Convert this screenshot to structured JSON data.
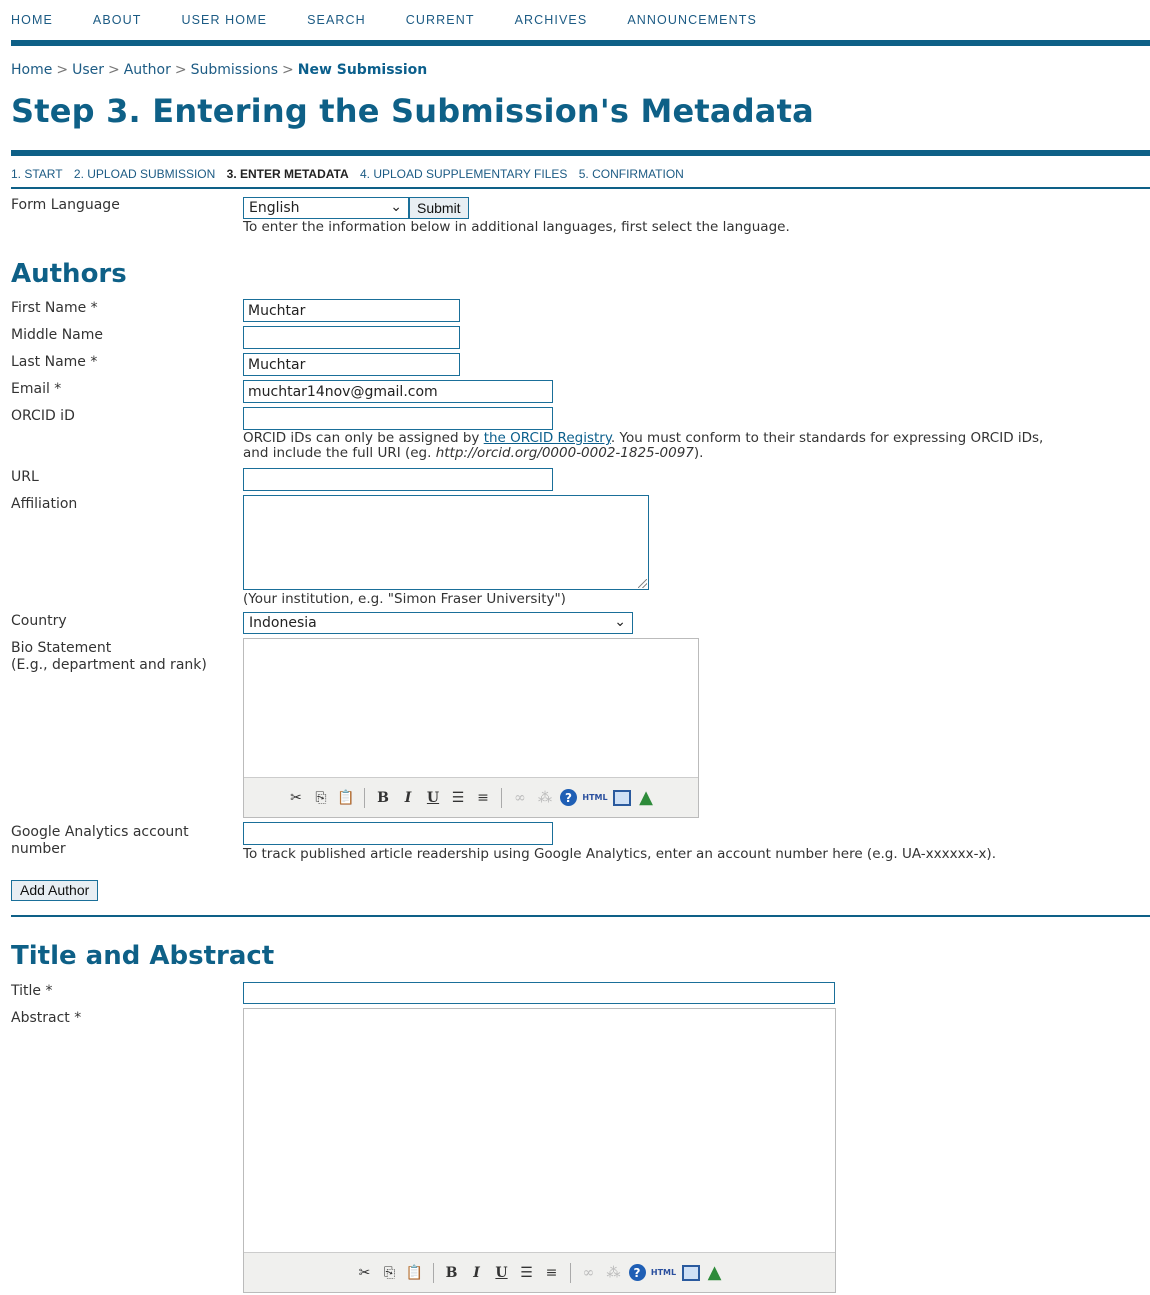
{
  "nav": [
    "HOME",
    "ABOUT",
    "USER HOME",
    "SEARCH",
    "CURRENT",
    "ARCHIVES",
    "ANNOUNCEMENTS"
  ],
  "breadcrumb": [
    "Home",
    "User",
    "Author",
    "Submissions",
    "New Submission"
  ],
  "breadcrumb_separator": ">",
  "page_title": "Step 3. Entering the Submission's Metadata",
  "steps": [
    {
      "label": "1. START"
    },
    {
      "label": "2. UPLOAD SUBMISSION"
    },
    {
      "label": "3. ENTER METADATA",
      "active": true
    },
    {
      "label": "4. UPLOAD SUPPLEMENTARY FILES"
    },
    {
      "label": "5. CONFIRMATION"
    }
  ],
  "form_language": {
    "label": "Form Language",
    "value": "English",
    "submit_label": "Submit",
    "note": "To enter the information below in additional languages, first select the language."
  },
  "authors": {
    "heading": "Authors",
    "first_name": {
      "label": "First Name *",
      "value": "Muchtar"
    },
    "middle_name": {
      "label": "Middle Name",
      "value": ""
    },
    "last_name": {
      "label": "Last Name *",
      "value": "Muchtar"
    },
    "email": {
      "label": "Email *",
      "value": "muchtar14nov@gmail.com"
    },
    "orcid": {
      "label": "ORCID iD",
      "value": "",
      "note_before": "ORCID iDs can only be assigned by ",
      "note_link": "the ORCID Registry",
      "note_after": ". You must conform to their standards for expressing ORCID iDs,",
      "note_line2_before": "and include the full URI (eg. ",
      "note_line2_italic": "http://orcid.org/0000-0002-1825-0097",
      "note_line2_after": ")."
    },
    "url": {
      "label": "URL",
      "value": ""
    },
    "affiliation": {
      "label": "Affiliation",
      "note": "(Your institution, e.g. \"Simon Fraser University\")"
    },
    "country": {
      "label": "Country",
      "value": "Indonesia"
    },
    "bio": {
      "label_line1": "Bio Statement",
      "label_line2": "(E.g., department and rank)"
    },
    "analytics": {
      "label_line1": "Google Analytics account",
      "label_line2": "number",
      "value": "",
      "note": "To track published article readership using Google Analytics, enter an account number here (e.g. UA-xxxxxx-x)."
    },
    "add_author_label": "Add Author"
  },
  "title_abstract": {
    "heading": "Title and Abstract",
    "title": {
      "label": "Title *",
      "value": ""
    },
    "abstract": {
      "label": "Abstract *"
    }
  },
  "toolbar_icons": [
    "cut-icon",
    "copy-icon",
    "paste-icon",
    "bold-icon",
    "italic-icon",
    "underline-icon",
    "bullet-list-icon",
    "numbered-list-icon",
    "link-icon",
    "unlink-icon",
    "help-icon",
    "html-icon",
    "fullscreen-icon",
    "insert-image-icon"
  ],
  "colors": {
    "brand": "#0e6087",
    "link": "#1c5b84"
  }
}
